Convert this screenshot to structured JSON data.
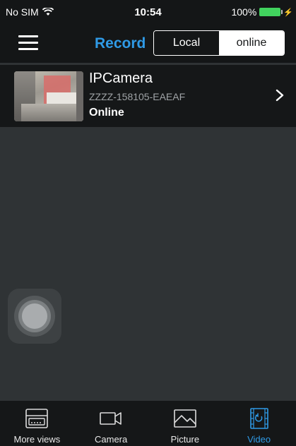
{
  "status_bar": {
    "carrier": "No SIM",
    "time": "10:54",
    "battery": "100%"
  },
  "nav": {
    "title": "Record",
    "segments": [
      "Local",
      "online"
    ],
    "selected_segment": "online"
  },
  "camera": {
    "name": "IPCamera",
    "id": "ZZZZ-158105-EAEAF",
    "status": "Online"
  },
  "tabs": [
    {
      "label": "More views",
      "icon": "multi-view-icon",
      "active": false
    },
    {
      "label": "Camera",
      "icon": "camera-icon",
      "active": false
    },
    {
      "label": "Picture",
      "icon": "picture-icon",
      "active": false
    },
    {
      "label": "Video",
      "icon": "video-icon",
      "active": true
    }
  ],
  "colors": {
    "accent": "#2f9ae6",
    "background": "#2f3335",
    "bar": "#141617",
    "battery": "#41d35e"
  }
}
